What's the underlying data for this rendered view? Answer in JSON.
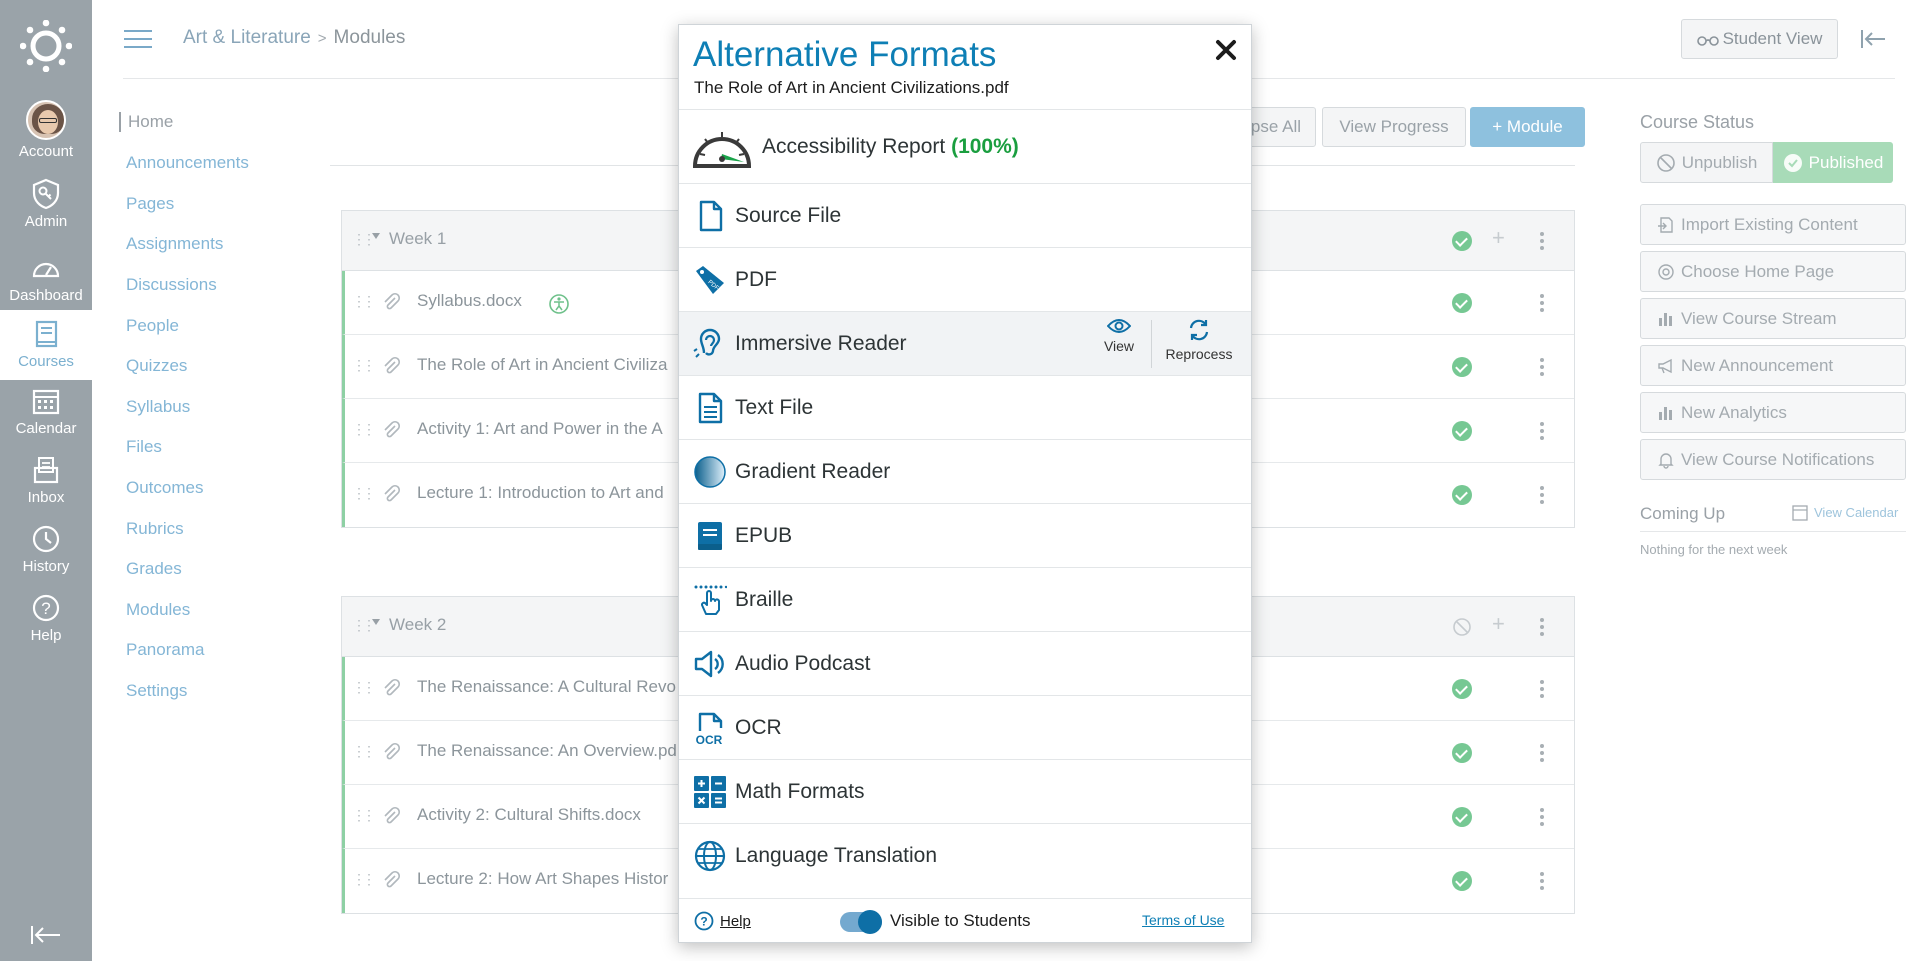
{
  "global_nav": {
    "account": "Account",
    "admin": "Admin",
    "dashboard": "Dashboard",
    "courses": "Courses",
    "calendar": "Calendar",
    "inbox": "Inbox",
    "history": "History",
    "help": "Help"
  },
  "header": {
    "breadcrumb_course": "Art & Literature",
    "breadcrumb_sep": ">",
    "breadcrumb_page": "Modules",
    "student_view": "Student View"
  },
  "course_nav": [
    "Home",
    "Announcements",
    "Pages",
    "Assignments",
    "Discussions",
    "People",
    "Quizzes",
    "Syllabus",
    "Files",
    "Outcomes",
    "Rubrics",
    "Grades",
    "Modules",
    "Panorama",
    "Settings"
  ],
  "toolbar": {
    "collapse_all_partial": "pse All",
    "view_progress": "View Progress",
    "add_module": "+ Module"
  },
  "modules": [
    {
      "title": "Week 1",
      "items": [
        "Syllabus.docx",
        "The Role of Art in Ancient Civiliza",
        "Activity 1: Art and Power in the A",
        "Lecture 1: Introduction to Art and"
      ]
    },
    {
      "title": "Week 2",
      "items": [
        "The Renaissance: A Cultural Revo",
        "The Renaissance: An Overview.pd",
        "Activity 2: Cultural Shifts.docx",
        "Lecture 2: How Art Shapes Histor"
      ]
    }
  ],
  "course_status": {
    "title": "Course Status",
    "unpublish": "Unpublish",
    "published": "Published",
    "actions": [
      "Import Existing Content",
      "Choose Home Page",
      "View Course Stream",
      "New Announcement",
      "New Analytics",
      "View Course Notifications"
    ],
    "coming_up": "Coming Up",
    "view_calendar": "View Calendar",
    "nothing": "Nothing for the next week"
  },
  "modal": {
    "title": "Alternative Formats",
    "subtitle": "The Role of Art in Ancient Civilizations.pdf",
    "report_label": "Accessibility Report",
    "report_score": "(100%)",
    "formats": [
      "Source File",
      "PDF",
      "Immersive Reader",
      "Text File",
      "Gradient Reader",
      "EPUB",
      "Braille",
      "Audio Podcast",
      "OCR",
      "Math Formats",
      "Language Translation"
    ],
    "view": "View",
    "reprocess": "Reprocess",
    "help": "Help",
    "visible": "Visible to Students",
    "terms": "Terms of Use"
  },
  "colors": {
    "nav_bg": "#9aa3a9",
    "link": "#84b6d6",
    "primary": "#0e7fb5",
    "success": "#1a9e3f"
  }
}
